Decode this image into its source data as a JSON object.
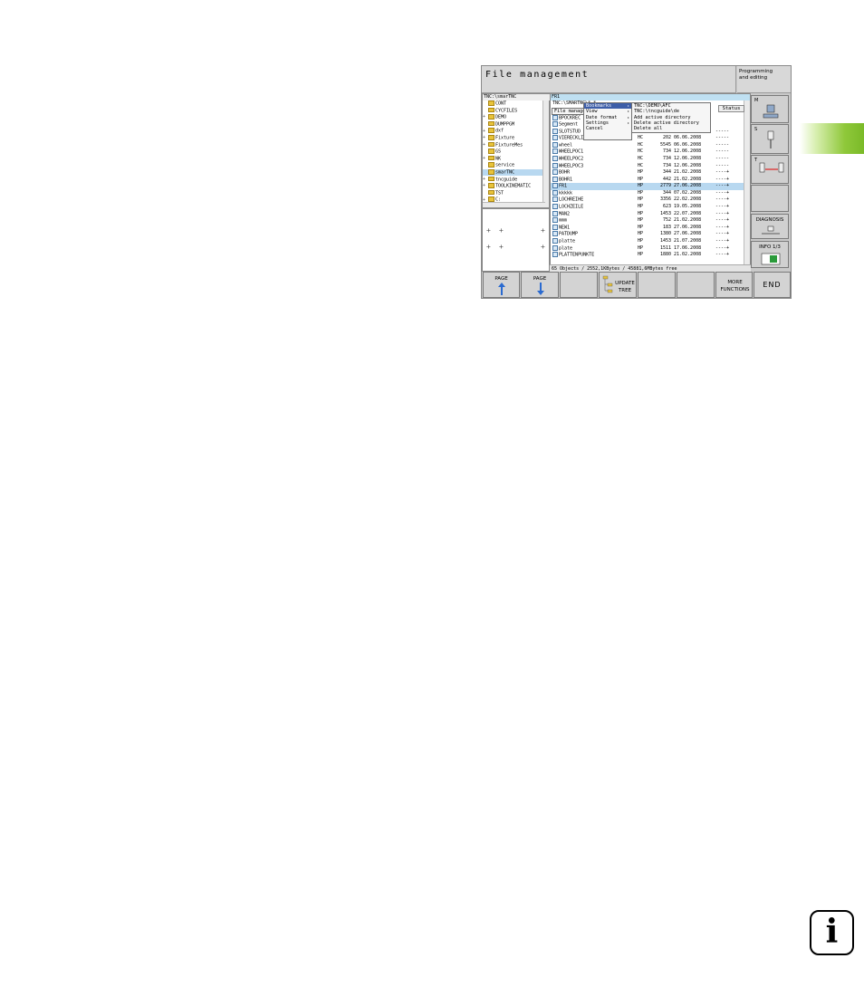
{
  "window": {
    "title": "File management",
    "mode": "Programming\nand editing"
  },
  "tree": {
    "path": "TNC:\\smarTNC",
    "items": [
      {
        "label": "CONT",
        "exp": ""
      },
      {
        "label": "CYCFILES",
        "exp": ""
      },
      {
        "label": "DEMO",
        "exp": "+"
      },
      {
        "label": "DUMPPGM",
        "exp": ""
      },
      {
        "label": "dxf",
        "exp": "+"
      },
      {
        "label": "Fixture",
        "exp": "+"
      },
      {
        "label": "FixtureMes",
        "exp": "+"
      },
      {
        "label": "GS",
        "exp": ""
      },
      {
        "label": "NK",
        "exp": "+"
      },
      {
        "label": "service",
        "exp": ""
      },
      {
        "label": "smarTNC",
        "exp": ""
      },
      {
        "label": "tncguide",
        "exp": "+"
      },
      {
        "label": "TOOLKINEMATIC",
        "exp": "+"
      },
      {
        "label": "TST",
        "exp": ""
      },
      {
        "label": "C:",
        "exp": "+"
      }
    ]
  },
  "files": {
    "path": "FR1",
    "subpath": "TNC:\\SMARTNC\\*.*",
    "status_header": "Status",
    "rows": [
      {
        "name": "BPOCKREC",
        "type": "",
        "size": "",
        "date": "",
        "status": ""
      },
      {
        "name": "Segment",
        "type": "",
        "size": "",
        "date": "",
        "status": ""
      },
      {
        "name": "SLOTSTUD",
        "type": "HC",
        "size": "210",
        "date": "06.06.2008",
        "status": "-----"
      },
      {
        "name": "VIERECKLINKS",
        "type": "HC",
        "size": "202",
        "date": "06.06.2008",
        "status": "-----"
      },
      {
        "name": "wheel",
        "type": "HC",
        "size": "5545",
        "date": "06.06.2008",
        "status": "-----"
      },
      {
        "name": "WHEELPOC1",
        "type": "HC",
        "size": "734",
        "date": "12.06.2008",
        "status": "-----"
      },
      {
        "name": "WHEELPOC2",
        "type": "HC",
        "size": "734",
        "date": "12.06.2008",
        "status": "-----"
      },
      {
        "name": "WHEELPOC3",
        "type": "HC",
        "size": "734",
        "date": "12.06.2008",
        "status": "-----"
      },
      {
        "name": "BOHR",
        "type": "HP",
        "size": "344",
        "date": "21.02.2008",
        "status": "----+"
      },
      {
        "name": "BOHR1",
        "type": "HP",
        "size": "442",
        "date": "21.02.2008",
        "status": "----+"
      },
      {
        "name": "FR1",
        "type": "HP",
        "size": "2779",
        "date": "27.06.2008",
        "status": "----+"
      },
      {
        "name": "kkkkk",
        "type": "HP",
        "size": "344",
        "date": "07.02.2008",
        "status": "----+"
      },
      {
        "name": "LOCHREIHE",
        "type": "HP",
        "size": "3356",
        "date": "22.02.2008",
        "status": "----+"
      },
      {
        "name": "LOCHZEILE",
        "type": "HP",
        "size": "623",
        "date": "19.05.2008",
        "status": "----+"
      },
      {
        "name": "MAN2",
        "type": "HP",
        "size": "1453",
        "date": "22.07.2008",
        "status": "----+"
      },
      {
        "name": "mmm",
        "type": "HP",
        "size": "752",
        "date": "21.02.2008",
        "status": "----+"
      },
      {
        "name": "NEW1",
        "type": "HP",
        "size": "183",
        "date": "27.06.2008",
        "status": "----+"
      },
      {
        "name": "PATDUMP",
        "type": "HP",
        "size": "1380",
        "date": "27.06.2008",
        "status": "----+"
      },
      {
        "name": "platte",
        "type": "HP",
        "size": "1453",
        "date": "21.07.2008",
        "status": "----+"
      },
      {
        "name": "plate",
        "type": "HP",
        "size": "1511",
        "date": "17.06.2008",
        "status": "----+"
      },
      {
        "name": "PLATTENPUNKTE",
        "type": "HP",
        "size": "1880",
        "date": "21.02.2008",
        "status": "----+"
      }
    ],
    "status_line": "65 Objects / 2552,1KBytes / 45881,6MBytes free"
  },
  "menus": {
    "main": [
      {
        "label": "File management",
        "arrow": ""
      }
    ],
    "submenu": [
      {
        "label": "Bookmarks",
        "arrow": "▸"
      },
      {
        "label": "View",
        "arrow": "▸"
      },
      {
        "label": "Date format",
        "arrow": "▸"
      },
      {
        "label": "Settings",
        "arrow": "▸"
      },
      {
        "label": "Cancel",
        "arrow": ""
      }
    ],
    "bookmarks": [
      {
        "label": "TNC:\\DEMO\\AFC"
      },
      {
        "label": "TNC:\\tncguide\\de"
      },
      {
        "label": "Add active directory"
      },
      {
        "label": "Delete active directory"
      },
      {
        "label": "Delete all"
      }
    ]
  },
  "softkeys_right": [
    {
      "label": "M"
    },
    {
      "label": "S"
    },
    {
      "label": "T"
    },
    {
      "label": ""
    },
    {
      "label": "DIAGNOSIS"
    },
    {
      "label": "INFO 1/3"
    }
  ],
  "softkeys_bottom": [
    {
      "label": "PAGE"
    },
    {
      "label": "PAGE"
    },
    {
      "label": ""
    },
    {
      "label": "UPDATE TREE"
    },
    {
      "label": ""
    },
    {
      "label": ""
    },
    {
      "label": "MORE FUNCTIONS"
    },
    {
      "label": "END"
    }
  ]
}
